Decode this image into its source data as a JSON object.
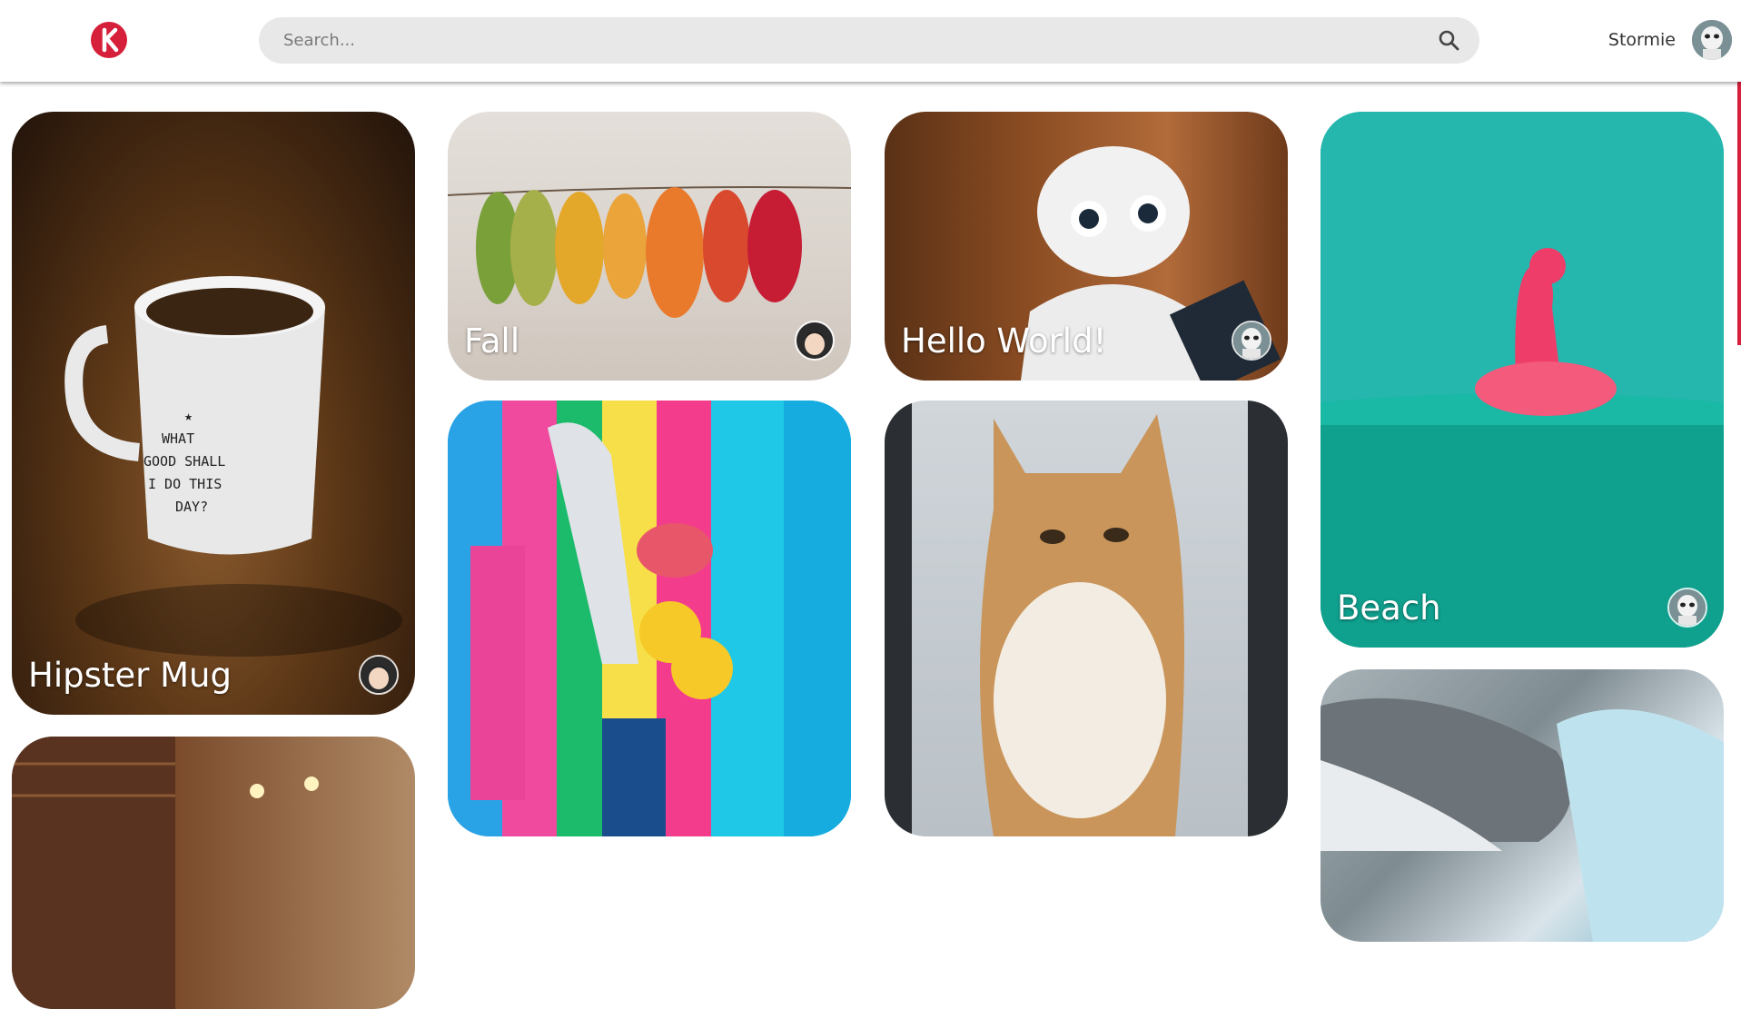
{
  "header": {
    "logo_letter": "K",
    "search": {
      "placeholder": "Search..."
    },
    "user": {
      "name": "Stormie"
    }
  },
  "pins": [
    {
      "title": "Hipster Mug",
      "owner_avatar": "anime-girl-avatar"
    },
    {
      "title": "Fall",
      "owner_avatar": "anime-girl-avatar"
    },
    {
      "title": "Hello World!",
      "owner_avatar": "stormtrooper-avatar"
    },
    {
      "title": "Beach",
      "owner_avatar": "stormtrooper-avatar"
    },
    {
      "title": "",
      "owner_avatar": ""
    },
    {
      "title": "",
      "owner_avatar": ""
    },
    {
      "title": "",
      "owner_avatar": ""
    },
    {
      "title": "",
      "owner_avatar": ""
    }
  ],
  "mug_text": "WHAT GOOD SHALL I DO THIS DAY?",
  "colors": {
    "brand": "#d61f3a",
    "search_bg": "#e8e8e8"
  }
}
